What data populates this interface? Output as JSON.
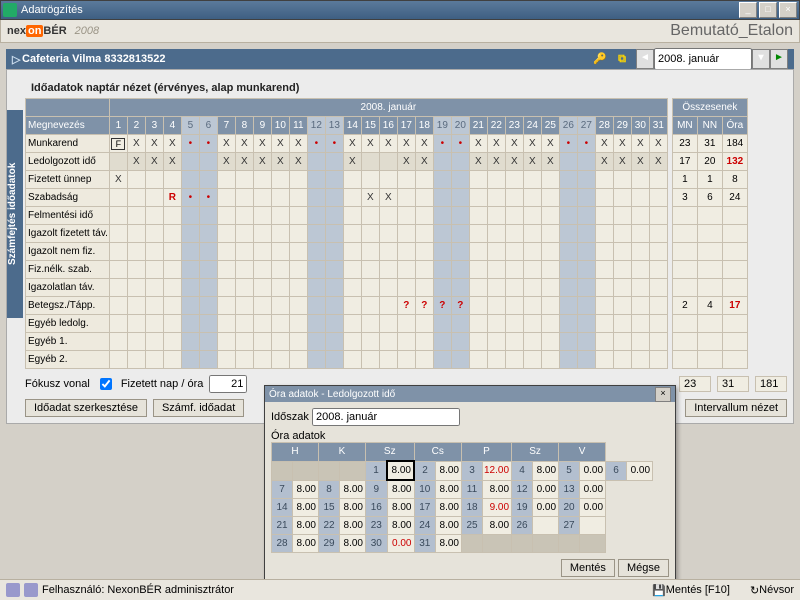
{
  "window": {
    "title": "Adatrögzítés"
  },
  "brand": {
    "name1": "nex",
    "on": "on",
    "name2": "BÉR",
    "year": "2008",
    "right": "Bemutató_Etalon"
  },
  "header": {
    "title": "Cafeteria Vilma 8332813522",
    "period": "2008. január"
  },
  "subtitle": "Időadatok naptár nézet (érvényes, alap munkarend)",
  "sidetab": "Számfejtés időadatok",
  "month_header": "2008. január",
  "sum_header": "Összesenek",
  "col_label": "Megnevezés",
  "days": [
    "1",
    "2",
    "3",
    "4",
    "5",
    "6",
    "7",
    "8",
    "9",
    "10",
    "11",
    "12",
    "13",
    "14",
    "15",
    "16",
    "17",
    "18",
    "19",
    "20",
    "21",
    "22",
    "23",
    "24",
    "25",
    "26",
    "27",
    "28",
    "29",
    "30",
    "31"
  ],
  "weekend_idx": [
    4,
    5,
    11,
    12,
    18,
    19,
    25,
    26
  ],
  "sum_cols": [
    "MN",
    "NN",
    "Óra"
  ],
  "rows": [
    {
      "label": "Munkarend",
      "cells": [
        "F",
        "X",
        "X",
        "X",
        "•",
        "•",
        "X",
        "X",
        "X",
        "X",
        "X",
        "•",
        "•",
        "X",
        "X",
        "X",
        "X",
        "X",
        "•",
        "•",
        "X",
        "X",
        "X",
        "X",
        "X",
        "•",
        "•",
        "X",
        "X",
        "X",
        "X"
      ],
      "sum": [
        "23",
        "31",
        "184"
      ]
    },
    {
      "label": "Ledolgozott idő",
      "cells": [
        "",
        "X",
        "X",
        "X",
        "",
        "",
        "X",
        "X",
        "X",
        "X",
        "X",
        "",
        "",
        "X",
        "",
        "",
        "X",
        "X",
        "",
        "",
        "X",
        "X",
        "X",
        "X",
        "X",
        "",
        "",
        "X",
        "X",
        "X",
        "X"
      ],
      "sum": [
        "17",
        "20",
        "132"
      ],
      "sum_red": 2,
      "selected": true
    },
    {
      "label": "Fizetett ünnep",
      "cells": [
        "X",
        "",
        "",
        "",
        "",
        "",
        "",
        "",
        "",
        "",
        "",
        "",
        "",
        "",
        "",
        "",
        "",
        "",
        "",
        "",
        "",
        "",
        "",
        "",
        "",
        "",
        "",
        "",
        "",
        "",
        ""
      ],
      "sum": [
        "1",
        "1",
        "8"
      ]
    },
    {
      "label": "Szabadság",
      "cells": [
        "",
        "",
        "",
        "R",
        "•",
        "•",
        "",
        "",
        "",
        "",
        "",
        "",
        "",
        "",
        "X",
        "X",
        "",
        "",
        "",
        "",
        "",
        "",
        "",
        "",
        "",
        "",
        "",
        "",
        "",
        "",
        ""
      ],
      "sum": [
        "3",
        "6",
        "24"
      ]
    },
    {
      "label": "Felmentési idő",
      "cells": [
        "",
        "",
        "",
        "",
        "",
        "",
        "",
        "",
        "",
        "",
        "",
        "",
        "",
        "",
        "",
        "",
        "",
        "",
        "",
        "",
        "",
        "",
        "",
        "",
        "",
        "",
        "",
        "",
        "",
        "",
        ""
      ],
      "sum": [
        "",
        "",
        ""
      ]
    },
    {
      "label": "Igazolt fizetett táv.",
      "cells": [
        "",
        "",
        "",
        "",
        "",
        "",
        "",
        "",
        "",
        "",
        "",
        "",
        "",
        "",
        "",
        "",
        "",
        "",
        "",
        "",
        "",
        "",
        "",
        "",
        "",
        "",
        "",
        "",
        "",
        "",
        ""
      ],
      "sum": [
        "",
        "",
        ""
      ]
    },
    {
      "label": "Igazolt nem fiz.",
      "cells": [
        "",
        "",
        "",
        "",
        "",
        "",
        "",
        "",
        "",
        "",
        "",
        "",
        "",
        "",
        "",
        "",
        "",
        "",
        "",
        "",
        "",
        "",
        "",
        "",
        "",
        "",
        "",
        "",
        "",
        "",
        ""
      ],
      "sum": [
        "",
        "",
        ""
      ]
    },
    {
      "label": "Fiz.nélk. szab.",
      "cells": [
        "",
        "",
        "",
        "",
        "",
        "",
        "",
        "",
        "",
        "",
        "",
        "",
        "",
        "",
        "",
        "",
        "",
        "",
        "",
        "",
        "",
        "",
        "",
        "",
        "",
        "",
        "",
        "",
        "",
        "",
        ""
      ],
      "sum": [
        "",
        "",
        ""
      ]
    },
    {
      "label": "Igazolatlan táv.",
      "cells": [
        "",
        "",
        "",
        "",
        "",
        "",
        "",
        "",
        "",
        "",
        "",
        "",
        "",
        "",
        "",
        "",
        "",
        "",
        "",
        "",
        "",
        "",
        "",
        "",
        "",
        "",
        "",
        "",
        "",
        "",
        ""
      ],
      "sum": [
        "",
        "",
        ""
      ]
    },
    {
      "label": "Betegsz./Tápp.",
      "cells": [
        "",
        "",
        "",
        "",
        "",
        "",
        "",
        "",
        "",
        "",
        "",
        "",
        "",
        "",
        "",
        "",
        "?",
        "?",
        "?",
        "?",
        "",
        "",
        "",
        "",
        "",
        "",
        "",
        "",
        "",
        "",
        ""
      ],
      "sum": [
        "2",
        "4",
        "17"
      ],
      "sum_red": 2
    },
    {
      "label": "Egyéb ledolg.",
      "cells": [
        "",
        "",
        "",
        "",
        "",
        "",
        "",
        "",
        "",
        "",
        "",
        "",
        "",
        "",
        "",
        "",
        "",
        "",
        "",
        "",
        "",
        "",
        "",
        "",
        "",
        "",
        "",
        "",
        "",
        "",
        ""
      ],
      "sum": [
        "",
        "",
        ""
      ]
    },
    {
      "label": "Egyéb 1.",
      "cells": [
        "",
        "",
        "",
        "",
        "",
        "",
        "",
        "",
        "",
        "",
        "",
        "",
        "",
        "",
        "",
        "",
        "",
        "",
        "",
        "",
        "",
        "",
        "",
        "",
        "",
        "",
        "",
        "",
        "",
        "",
        ""
      ],
      "sum": [
        "",
        "",
        ""
      ]
    },
    {
      "label": "Egyéb 2.",
      "cells": [
        "",
        "",
        "",
        "",
        "",
        "",
        "",
        "",
        "",
        "",
        "",
        "",
        "",
        "",
        "",
        "",
        "",
        "",
        "",
        "",
        "",
        "",
        "",
        "",
        "",
        "",
        "",
        "",
        "",
        "",
        ""
      ],
      "sum": [
        "",
        "",
        ""
      ]
    }
  ],
  "focus": {
    "label": "Fókusz vonal",
    "chk_label": "Fizetett nap / óra",
    "value": "21"
  },
  "bottom_totals": [
    "23",
    "31",
    "181"
  ],
  "buttons": {
    "edit": "Időadat szerkesztése",
    "payroll": "Számf. időadat",
    "interval": "Intervallum nézet"
  },
  "dialog": {
    "title": "Óra adatok - Ledolgozott idő",
    "period_label": "Időszak",
    "period_value": "2008. január",
    "section": "Óra adatok",
    "dow": [
      "H",
      "K",
      "Sz",
      "Cs",
      "P",
      "Sz",
      "V"
    ],
    "cal": [
      [
        null,
        null,
        [
          "1",
          "8.00",
          "sel"
        ],
        [
          "2",
          "8.00"
        ],
        [
          "3",
          "12.00",
          "red"
        ],
        [
          "4",
          "8.00"
        ],
        [
          "5",
          "0.00"
        ],
        [
          "6",
          "0.00"
        ]
      ],
      [
        [
          "7",
          "8.00"
        ],
        [
          "8",
          "8.00"
        ],
        [
          "9",
          "8.00"
        ],
        [
          "10",
          "8.00"
        ],
        [
          "11",
          "8.00"
        ],
        [
          "12",
          "0.00"
        ],
        [
          "13",
          "0.00"
        ]
      ],
      [
        [
          "14",
          "8.00"
        ],
        [
          "15",
          "8.00"
        ],
        [
          "16",
          "8.00"
        ],
        [
          "17",
          "8.00"
        ],
        [
          "18",
          "9.00",
          "red"
        ],
        [
          "19",
          "0.00"
        ],
        [
          "20",
          "0.00"
        ]
      ],
      [
        [
          "21",
          "8.00"
        ],
        [
          "22",
          "8.00"
        ],
        [
          "23",
          "8.00"
        ],
        [
          "24",
          "8.00"
        ],
        [
          "25",
          "8.00"
        ],
        [
          "26",
          "",
          ""
        ],
        [
          "27",
          "",
          ""
        ]
      ],
      [
        [
          "28",
          "8.00"
        ],
        [
          "29",
          "8.00"
        ],
        [
          "30",
          "0.00",
          "red"
        ],
        [
          "31",
          "8.00"
        ],
        null,
        null,
        null
      ]
    ],
    "save": "Mentés",
    "cancel": "Mégse"
  },
  "status": {
    "user_label": "Felhasználó: NexonBÉR adminisztrátor",
    "save": "Mentés [F10]",
    "list": "Névsor"
  }
}
